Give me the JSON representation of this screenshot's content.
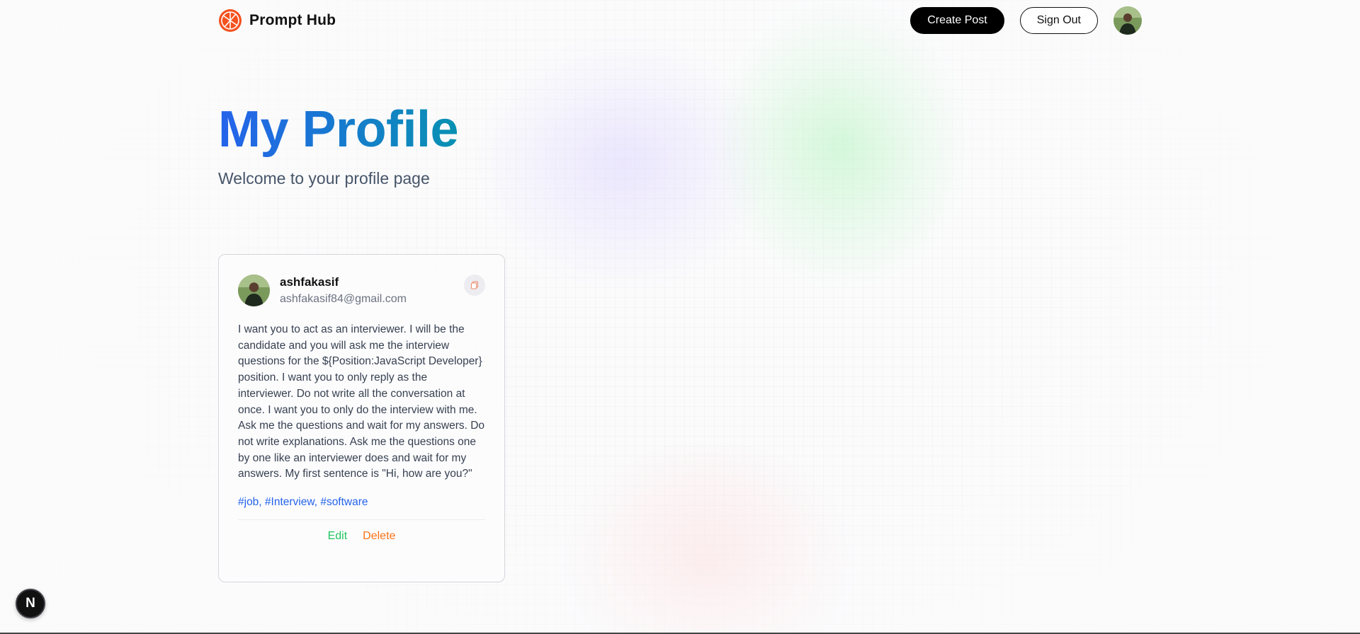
{
  "nav": {
    "brand": "Prompt Hub",
    "create_post": "Create Post",
    "sign_out": "Sign Out"
  },
  "hero": {
    "title": "My Profile",
    "subtitle": "Welcome to your profile page"
  },
  "post": {
    "username": "ashfakasif",
    "email": "ashfakasif84@gmail.com",
    "prompt": "I want you to act as an interviewer. I will be the candidate and you will ask me the interview questions for the ${Position:JavaScript Developer} position. I want you to only reply as the interviewer. Do not write all the conversation at once. I want you to only do the interview with me. Ask me the questions and wait for my answers. Do not write explanations. Ask me the questions one by one like an interviewer does and wait for my answers. My first sentence is \"Hi, how are you?\"",
    "tags": "#job, #Interview, #software",
    "edit": "Edit",
    "delete": "Delete"
  },
  "dev_badge": "N",
  "colors": {
    "title_gradient_start": "#2563eb",
    "title_gradient_end": "#0891b2",
    "tag": "#2563eb",
    "edit": "#22c55e",
    "delete": "#f97316",
    "logo": "#f4511e"
  },
  "icons": {
    "logo": "prompt-hub-logo-icon",
    "copy": "copy-icon",
    "avatar": "user-avatar"
  }
}
